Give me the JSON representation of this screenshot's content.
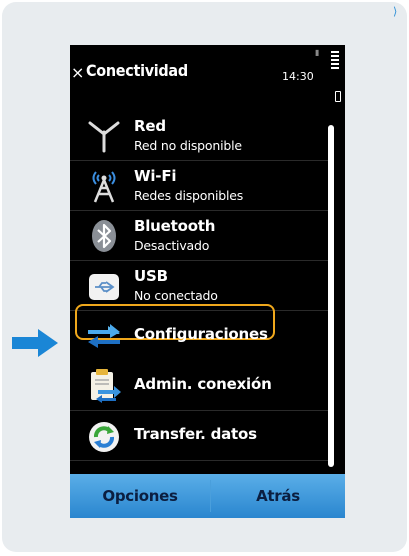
{
  "colors": {
    "accent_blue": "#2a86cf",
    "highlight": "#f0a81c",
    "screen_bg": "#000000",
    "panel_bg": "#e8ecef"
  },
  "titlebar": {
    "close_glyph": "×",
    "title": "Conectividad",
    "clock": "14:30"
  },
  "items": [
    {
      "icon": "antenna-icon",
      "title": "Red",
      "subtitle": "Red no disponible"
    },
    {
      "icon": "wifi-tower-icon",
      "title": "Wi-Fi",
      "subtitle": "Redes disponibles"
    },
    {
      "icon": "bluetooth-icon",
      "title": "Bluetooth",
      "subtitle": "Desactivado"
    },
    {
      "icon": "usb-icon",
      "title": "USB",
      "subtitle": "No conectado"
    },
    {
      "icon": "settings-arrows-icon",
      "title": "Configuraciones"
    },
    {
      "icon": "connection-manager-icon",
      "title": "Admin. conexión"
    },
    {
      "icon": "data-transfer-icon",
      "title": "Transfer. datos"
    }
  ],
  "softkeys": {
    "left": "Opciones",
    "right": "Atrás"
  }
}
